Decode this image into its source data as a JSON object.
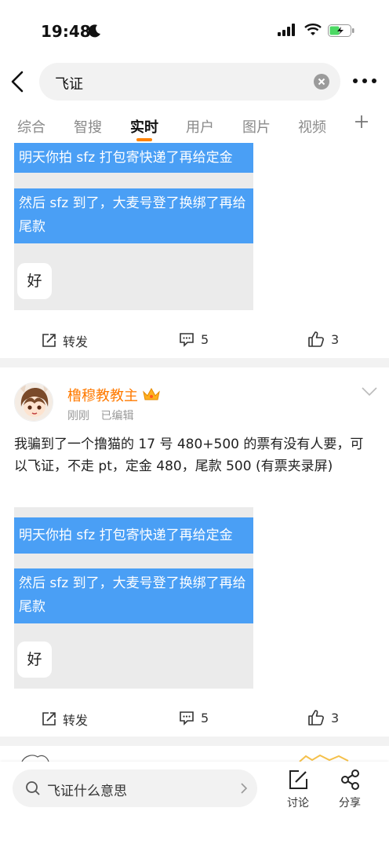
{
  "status_bar": {
    "time": "19:48"
  },
  "search": {
    "query": "飞证"
  },
  "tabs": [
    {
      "label": "综合"
    },
    {
      "label": "智搜"
    },
    {
      "label": "实时"
    },
    {
      "label": "用户"
    },
    {
      "label": "图片"
    },
    {
      "label": "视频"
    }
  ],
  "posts": [
    {
      "image_messages": [
        "明天你拍 sfz 打包寄快递了再给定金",
        "然后 sfz 到了，大麦号登了换绑了再给尾款",
        "好"
      ],
      "actions": {
        "repost": "转发",
        "comments": "5",
        "likes": "3"
      }
    },
    {
      "author": "橹穆教教主",
      "time": "刚刚",
      "edited": "已编辑",
      "text": "我骗到了一个撸猫的 17 号 480+500 的票有没有人要，可以飞证，不走 pt，定金 480，尾款 500 (有票夹录屏)",
      "image_messages": [
        "明天你拍 sfz 打包寄快递了再给定金",
        "然后 sfz 到了，大麦号登了换绑了再给尾款",
        "好"
      ],
      "actions": {
        "repost": "转发",
        "comments": "5",
        "likes": "3"
      }
    }
  ],
  "bottom_bar": {
    "search_placeholder": "飞证什么意思",
    "discuss_label": "讨论",
    "share_label": "分享"
  },
  "colors": {
    "accent": "#ff8200",
    "bubble_blue": "#4a9ff5",
    "username": "#ff7a00"
  }
}
